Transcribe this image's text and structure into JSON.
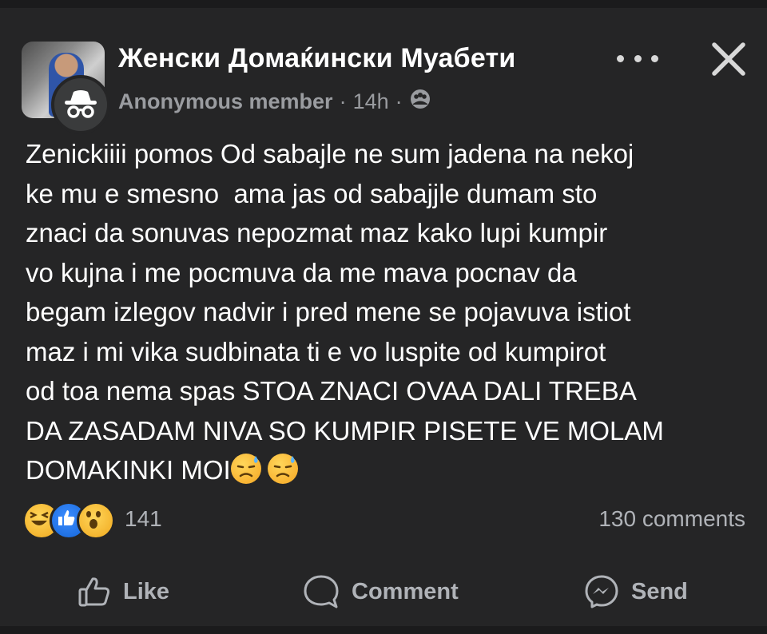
{
  "header": {
    "group_name": "Женски Домаќински Муабети",
    "author": "Anonymous member",
    "separator": "·",
    "time": "14h",
    "icons": {
      "more": "more-horizontal-icon",
      "close": "close-icon",
      "audience": "group-audience-icon",
      "anonymous": "incognito-icon"
    }
  },
  "post": {
    "text": "Zenickiiii pomos Od sabajle ne sum jadena na nekoj\nke mu e smesno  ama jas od sabajjle dumam sto\nznaci da sonuvas nepozmat maz kako lupi kumpir\nvo kujna i me pocmuva da me mava pocnav da\nbegam izlegov nadvir i pred mene se pojavuva istiot\nmaz i mi vika sudbinata ti e vo luspite od kumpirot\nod toa nema spas STOA ZNACI OVAA DALI TREBA\nDA ZASADAM NIVA SO KUMPIR PISETE VE MOLAM\nDOMAKINKI MOI",
    "trailing_emojis": [
      "downcast-face-with-sweat-emoji",
      "downcast-face-with-sweat-emoji"
    ]
  },
  "stats": {
    "reactions": [
      "haha",
      "like",
      "wow"
    ],
    "reaction_count": "141",
    "comment_count": "130 comments"
  },
  "actions": {
    "like": "Like",
    "comment": "Comment",
    "send": "Send"
  },
  "colors": {
    "background": "#252526",
    "text": "#ffffff",
    "secondary_text": "#b0b3b8",
    "like_blue": "#1466d8",
    "emoji_yellow": "#f6a623"
  }
}
